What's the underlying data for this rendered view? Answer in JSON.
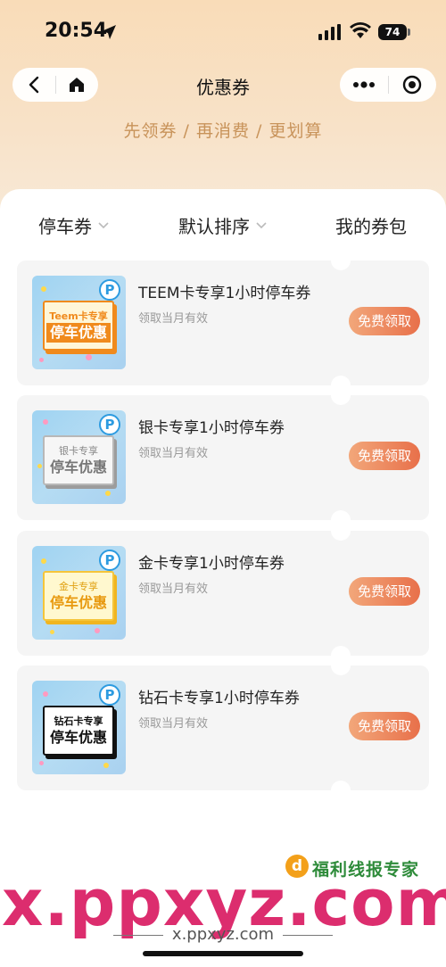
{
  "status_bar": {
    "time": "20:54",
    "battery": "74"
  },
  "nav": {
    "title": "优惠券",
    "back_icon": "chevron-left-icon",
    "home_icon": "home-icon",
    "more_icon": "more-dots-icon",
    "close_icon": "target-close-icon"
  },
  "slogan": "先领券 / 再消费 / 更划算",
  "filters": {
    "type_label": "停车券",
    "sort_label": "默认排序",
    "wallet_label": "我的券包"
  },
  "coupons": [
    {
      "title": "TEEM卡专享1小时停车券",
      "subtitle": "领取当月有效",
      "button": "免费领取",
      "thumb_line1": "Teem卡专享",
      "thumb_line2": "停车优惠",
      "thumb_badge": "P"
    },
    {
      "title": "银卡专享1小时停车券",
      "subtitle": "领取当月有效",
      "button": "免费领取",
      "thumb_line1": "银卡专享",
      "thumb_line2": "停车优惠",
      "thumb_badge": "P"
    },
    {
      "title": "金卡专享1小时停车券",
      "subtitle": "领取当月有效",
      "button": "免费领取",
      "thumb_line1": "金卡专享",
      "thumb_line2": "停车优惠",
      "thumb_badge": "P"
    },
    {
      "title": "钻石卡专享1小时停车券",
      "subtitle": "领取当月有效",
      "button": "免费领取",
      "thumb_line1": "钻石卡专享",
      "thumb_line2": "停车优惠",
      "thumb_badge": "P"
    }
  ],
  "watermark": {
    "logo_text": "福利线报专家",
    "logo_glyph": "d",
    "big_text": "x.ppxyz.com",
    "small_text": "x.ppxyz.com"
  },
  "colors": {
    "header_bg": "#f9dcb8",
    "slogan": "#c8935a",
    "button_start": "#f2a77a",
    "button_end": "#e8704a",
    "watermark": "#dc2d6e"
  }
}
